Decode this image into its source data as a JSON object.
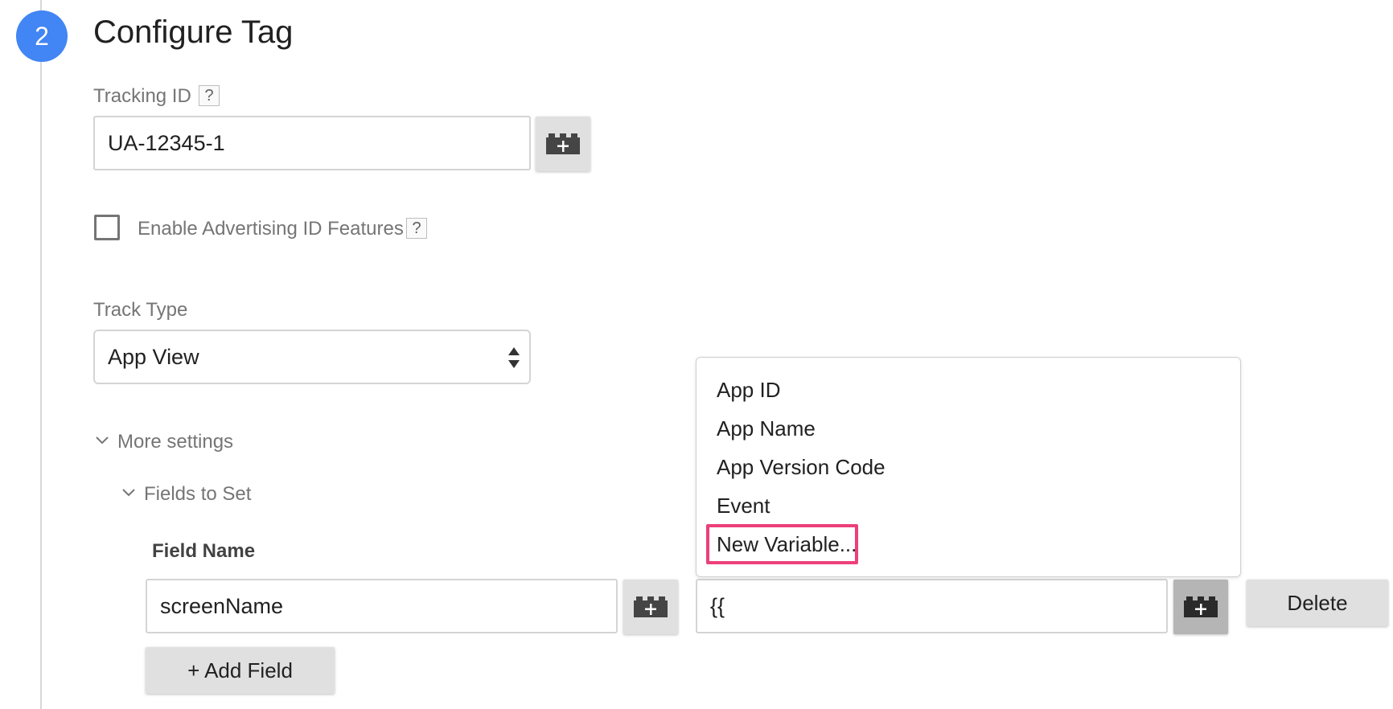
{
  "step": {
    "number": "2",
    "title": "Configure Tag"
  },
  "tracking_id": {
    "label": "Tracking ID",
    "help": "?",
    "value": "UA-12345-1"
  },
  "advertising": {
    "label": "Enable Advertising ID Features",
    "help": "?",
    "checked": false
  },
  "track_type": {
    "label": "Track Type",
    "selected": "App View"
  },
  "more_settings": {
    "label": "More settings",
    "expanded": true
  },
  "fields_to_set": {
    "label": "Fields to Set",
    "expanded": true,
    "header_field_name": "Field Name",
    "row": {
      "field_name": "screenName",
      "value": "{{"
    },
    "delete_label": "Delete",
    "add_field_label": "+ Add Field"
  },
  "variable_dropdown": {
    "items": [
      "App ID",
      "App Name",
      "App Version Code",
      "Event",
      "New Variable..."
    ],
    "highlighted": "New Variable..."
  },
  "colors": {
    "accent": "#4285f4",
    "highlight": "#ec407a"
  },
  "icons": [
    "variable-picker-icon",
    "chevron-down-icon",
    "select-arrows-icon",
    "help-icon"
  ]
}
